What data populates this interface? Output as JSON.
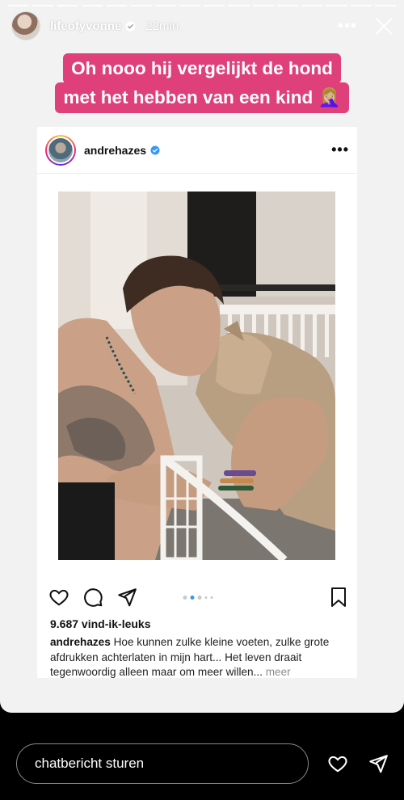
{
  "story": {
    "username": "lifeofyvonne",
    "time": "22min.",
    "progress_segments": 16,
    "caption_line1": "Oh nooo hij vergelijkt de hond",
    "caption_line2": "met het hebben van een kind 🤦🏼‍♀️",
    "caption_color": "#e0407a"
  },
  "post": {
    "username": "andrehazes",
    "likes": "9.687 vind-ik-leuks",
    "caption_user": "andrehazes",
    "caption_text": " Hoe kunnen zulke kleine voeten, zulke grote afdrukken achterlaten in mijn hart... Het leven draait tegenwoordig alleen maar om meer willen...",
    "more_label": " meer",
    "carousel_dots": 5,
    "carousel_active": 1
  },
  "footer": {
    "message_placeholder": "chatbericht sturen"
  },
  "icons": {
    "verified": "verified-badge-icon",
    "like": "heart-icon",
    "comment": "comment-icon",
    "share": "send-icon",
    "save": "bookmark-icon"
  },
  "colors": {
    "accent": "#3897f0",
    "brand_pink": "#e0407a"
  }
}
